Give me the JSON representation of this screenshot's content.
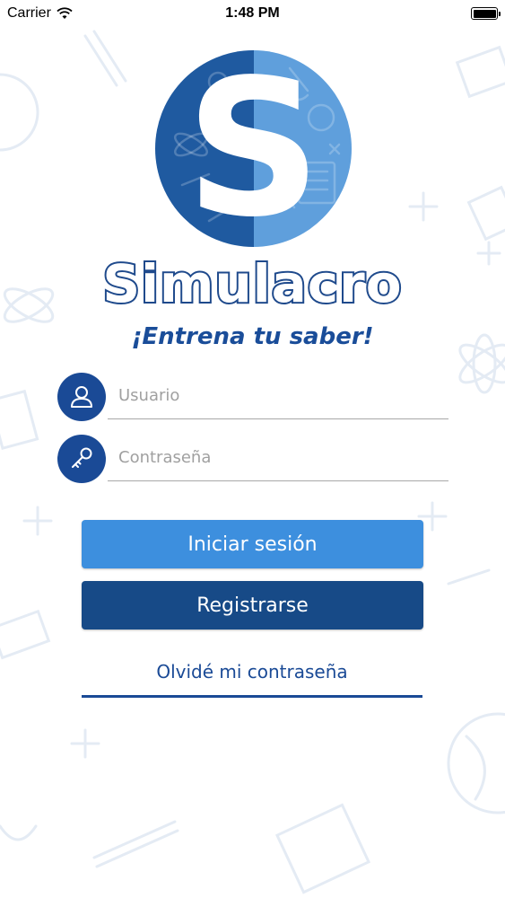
{
  "status_bar": {
    "carrier": "Carrier",
    "time": "1:48 PM",
    "battery_level": 1.0
  },
  "logo": {
    "letter": "S",
    "brand_name": "Simulacro",
    "tagline": "¡Entrena tu saber!",
    "colors": {
      "dark": "#1f5aa0",
      "light": "#5f9fdc",
      "outline": "#1f4a8c"
    }
  },
  "form": {
    "username": {
      "placeholder": "Usuario",
      "value": "",
      "icon": "user-icon"
    },
    "password": {
      "placeholder": "Contraseña",
      "value": "",
      "icon": "key-icon"
    }
  },
  "actions": {
    "login_label": "Iniciar sesión",
    "register_label": "Registrarse",
    "forgot_label": "Olvidé mi contraseña"
  },
  "colors": {
    "primary_light": "#3d8fde",
    "primary_dark": "#174a87",
    "icon_bg": "#1a4a96"
  }
}
